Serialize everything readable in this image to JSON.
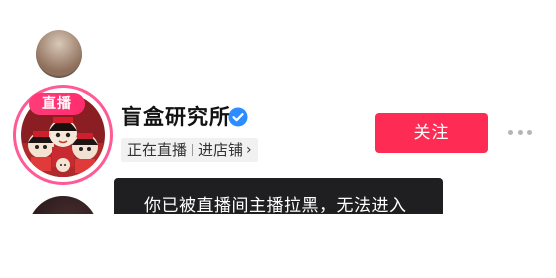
{
  "user": {
    "live_badge": "直播",
    "name": "盲盒研究所",
    "verified": true,
    "status_live": "正在直播",
    "status_shop": "进店铺",
    "status_chevron": "›"
  },
  "actions": {
    "follow_label": "关注"
  },
  "toast": {
    "message": "你已被直播间主播拉黑，无法进入"
  },
  "colors": {
    "brand": "#fe2c55",
    "live_ring": "#ff5a96",
    "verified": "#2d8cff",
    "toast_bg": "#1f1f21"
  },
  "icons": {
    "verified": "verified-check-icon",
    "more": "more-dots-icon",
    "chevron": "chevron-right-icon"
  }
}
